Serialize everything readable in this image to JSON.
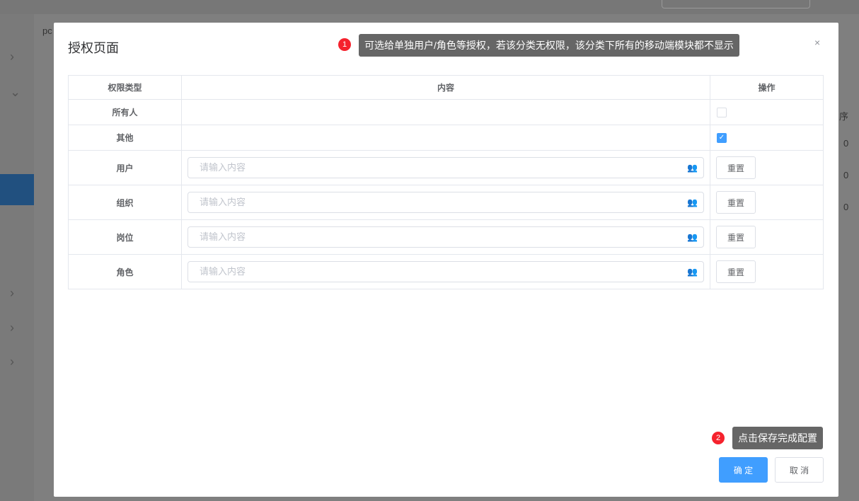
{
  "background": {
    "tab_label": "pc",
    "column_header": "序",
    "row_values": [
      "0",
      "0",
      "0"
    ]
  },
  "modal": {
    "title": "授权页面",
    "close_icon": "×",
    "table": {
      "headers": [
        "权限类型",
        "内容",
        "操作"
      ],
      "rows": [
        {
          "type": "所有人",
          "kind": "checkbox",
          "checked": false
        },
        {
          "type": "其他",
          "kind": "checkbox",
          "checked": true
        },
        {
          "type": "用户",
          "kind": "input",
          "placeholder": "请输入内容",
          "button": "重置"
        },
        {
          "type": "组织",
          "kind": "input",
          "placeholder": "请输入内容",
          "button": "重置"
        },
        {
          "type": "岗位",
          "kind": "input",
          "placeholder": "请输入内容",
          "button": "重置"
        },
        {
          "type": "角色",
          "kind": "input",
          "placeholder": "请输入内容",
          "button": "重置"
        }
      ]
    },
    "confirm_label": "确 定",
    "cancel_label": "取 消"
  },
  "tips": [
    {
      "num": "1",
      "text": "可选给单独用户/角色等授权，若该分类无权限，该分类下所有的移动端模块都不显示"
    },
    {
      "num": "2",
      "text": "点击保存完成配置"
    }
  ],
  "colors": {
    "primary": "#409eff",
    "badge": "#f5222d",
    "tooltip": "#666666"
  }
}
